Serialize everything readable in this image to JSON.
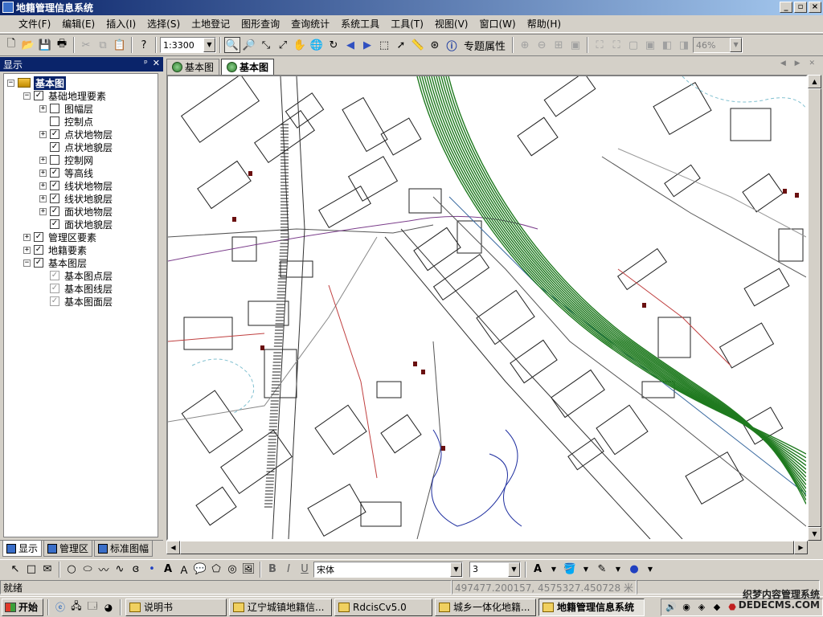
{
  "window": {
    "title": "地籍管理信息系统"
  },
  "menu": [
    "文件(F)",
    "编辑(E)",
    "插入(I)",
    "选择(S)",
    "土地登记",
    "图形查询",
    "查询统计",
    "系统工具",
    "工具(T)",
    "视图(V)",
    "窗口(W)",
    "帮助(H)"
  ],
  "toolbar": {
    "scale": "1:3300",
    "topic_label": "专题属性",
    "zoom_percent": "46%"
  },
  "left_panel": {
    "title": "显示",
    "tree": [
      {
        "label": "基本图",
        "level": 0,
        "expander": "minus",
        "check": "root",
        "selected": true
      },
      {
        "label": "基础地理要素",
        "level": 1,
        "expander": "minus",
        "check": "checked"
      },
      {
        "label": "图幅层",
        "level": 2,
        "expander": "plus",
        "check": "unchecked"
      },
      {
        "label": "控制点",
        "level": 2,
        "expander": "none",
        "check": "unchecked"
      },
      {
        "label": "点状地物层",
        "level": 2,
        "expander": "plus",
        "check": "checked"
      },
      {
        "label": "点状地貌层",
        "level": 2,
        "expander": "none",
        "check": "checked"
      },
      {
        "label": "控制网",
        "level": 2,
        "expander": "plus",
        "check": "unchecked"
      },
      {
        "label": "等高线",
        "level": 2,
        "expander": "plus",
        "check": "checked"
      },
      {
        "label": "线状地物层",
        "level": 2,
        "expander": "plus",
        "check": "checked"
      },
      {
        "label": "线状地貌层",
        "level": 2,
        "expander": "plus",
        "check": "checked"
      },
      {
        "label": "面状地物层",
        "level": 2,
        "expander": "plus",
        "check": "checked"
      },
      {
        "label": "面状地貌层",
        "level": 2,
        "expander": "none",
        "check": "checked"
      },
      {
        "label": "管理区要素",
        "level": 1,
        "expander": "plus",
        "check": "checked"
      },
      {
        "label": "地籍要素",
        "level": 1,
        "expander": "plus",
        "check": "checked"
      },
      {
        "label": "基本图层",
        "level": 1,
        "expander": "minus",
        "check": "checked"
      },
      {
        "label": "基本图点层",
        "level": 2,
        "expander": "none",
        "check": "grey"
      },
      {
        "label": "基本图线层",
        "level": 2,
        "expander": "none",
        "check": "grey"
      },
      {
        "label": "基本图面层",
        "level": 2,
        "expander": "none",
        "check": "grey"
      }
    ],
    "tabs": [
      "显示",
      "管理区",
      "标准图幅"
    ]
  },
  "doc_tabs": [
    "基本图",
    "基本图"
  ],
  "drawbar": {
    "font": "宋体",
    "font_size": "3"
  },
  "status": {
    "state": "就绪",
    "coords": "497477.200157, 4575327.450728 米"
  },
  "taskbar": {
    "start": "开始",
    "tasks": [
      "说明书",
      "辽宁城镇地籍信...",
      "RdcisCv5.0",
      "城乡一体化地籍...",
      "地籍管理信息系统"
    ]
  },
  "watermark": {
    "line1": "织梦内容管理系统",
    "line2": "DEDECMS.COM"
  },
  "colors": {
    "titlebar": "#0a246a",
    "contour_green": "#1f7a1f",
    "map_line": "#202020",
    "road_red": "#c04040"
  }
}
